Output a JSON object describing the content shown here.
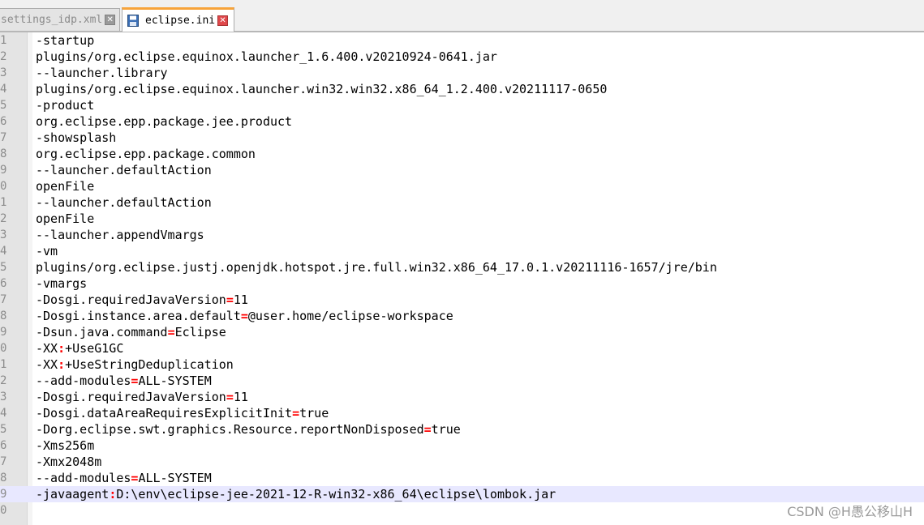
{
  "tabs": [
    {
      "label": "settings_idp.xml",
      "active": false,
      "close_icon": "close-icon"
    },
    {
      "label": "eclipse.ini",
      "active": true,
      "icon": "save-disk-icon",
      "close_icon": "close-icon"
    }
  ],
  "editor": {
    "current_line": 29,
    "lines": [
      {
        "num": "1",
        "parts": [
          {
            "t": "-startup"
          }
        ]
      },
      {
        "num": "2",
        "parts": [
          {
            "t": "plugins/org.eclipse.equinox.launcher_1.6.400.v20210924-0641.jar"
          }
        ]
      },
      {
        "num": "3",
        "parts": [
          {
            "t": "--launcher.library"
          }
        ]
      },
      {
        "num": "4",
        "parts": [
          {
            "t": "plugins/org.eclipse.equinox.launcher.win32.win32.x86_64_1.2.400.v20211117-0650"
          }
        ]
      },
      {
        "num": "5",
        "parts": [
          {
            "t": "-product"
          }
        ]
      },
      {
        "num": "6",
        "parts": [
          {
            "t": "org.eclipse.epp.package.jee.product"
          }
        ]
      },
      {
        "num": "7",
        "parts": [
          {
            "t": "-showsplash"
          }
        ]
      },
      {
        "num": "8",
        "parts": [
          {
            "t": "org.eclipse.epp.package.common"
          }
        ]
      },
      {
        "num": "9",
        "parts": [
          {
            "t": "--launcher.defaultAction"
          }
        ]
      },
      {
        "num": "0",
        "parts": [
          {
            "t": "openFile"
          }
        ]
      },
      {
        "num": "1",
        "parts": [
          {
            "t": "--launcher.defaultAction"
          }
        ]
      },
      {
        "num": "2",
        "parts": [
          {
            "t": "openFile"
          }
        ]
      },
      {
        "num": "3",
        "parts": [
          {
            "t": "--launcher.appendVmargs"
          }
        ]
      },
      {
        "num": "4",
        "parts": [
          {
            "t": "-vm"
          }
        ]
      },
      {
        "num": "5",
        "parts": [
          {
            "t": "plugins/org.eclipse.justj.openjdk.hotspot.jre.full.win32.x86_64_17.0.1.v20211116-1657/jre/bin"
          }
        ]
      },
      {
        "num": "6",
        "parts": [
          {
            "t": "-vmargs"
          }
        ]
      },
      {
        "num": "7",
        "parts": [
          {
            "t": "-Dosgi.requiredJavaVersion"
          },
          {
            "t": "=",
            "op": true
          },
          {
            "t": "11"
          }
        ]
      },
      {
        "num": "8",
        "parts": [
          {
            "t": "-Dosgi.instance.area.default"
          },
          {
            "t": "=",
            "op": true
          },
          {
            "t": "@user.home/eclipse-workspace"
          }
        ]
      },
      {
        "num": "9",
        "parts": [
          {
            "t": "-Dsun.java.command"
          },
          {
            "t": "=",
            "op": true
          },
          {
            "t": "Eclipse"
          }
        ]
      },
      {
        "num": "0",
        "parts": [
          {
            "t": "-XX"
          },
          {
            "t": ":",
            "op": true
          },
          {
            "t": "+UseG1GC"
          }
        ]
      },
      {
        "num": "1",
        "parts": [
          {
            "t": "-XX"
          },
          {
            "t": ":",
            "op": true
          },
          {
            "t": "+UseStringDeduplication"
          }
        ]
      },
      {
        "num": "2",
        "parts": [
          {
            "t": "--add-modules"
          },
          {
            "t": "=",
            "op": true
          },
          {
            "t": "ALL-SYSTEM"
          }
        ]
      },
      {
        "num": "3",
        "parts": [
          {
            "t": "-Dosgi.requiredJavaVersion"
          },
          {
            "t": "=",
            "op": true
          },
          {
            "t": "11"
          }
        ]
      },
      {
        "num": "4",
        "parts": [
          {
            "t": "-Dosgi.dataAreaRequiresExplicitInit"
          },
          {
            "t": "=",
            "op": true
          },
          {
            "t": "true"
          }
        ]
      },
      {
        "num": "5",
        "parts": [
          {
            "t": "-Dorg.eclipse.swt.graphics.Resource.reportNonDisposed"
          },
          {
            "t": "=",
            "op": true
          },
          {
            "t": "true"
          }
        ]
      },
      {
        "num": "6",
        "parts": [
          {
            "t": "-Xms256m"
          }
        ]
      },
      {
        "num": "7",
        "parts": [
          {
            "t": "-Xmx2048m"
          }
        ]
      },
      {
        "num": "8",
        "parts": [
          {
            "t": "--add-modules"
          },
          {
            "t": "=",
            "op": true
          },
          {
            "t": "ALL-SYSTEM"
          }
        ]
      },
      {
        "num": "9",
        "parts": [
          {
            "t": "-javaagent"
          },
          {
            "t": ":",
            "op": true
          },
          {
            "t": "D:\\env\\eclipse-jee-2021-12-R-win32-x86_64\\eclipse\\lombok.jar"
          }
        ]
      },
      {
        "num": "0",
        "parts": []
      }
    ]
  },
  "watermark": "CSDN @H愚公移山H",
  "colors": {
    "operator": "#ff0000",
    "current_line_bg": "#e8e8ff",
    "active_tab_accent": "#f7a33a"
  }
}
